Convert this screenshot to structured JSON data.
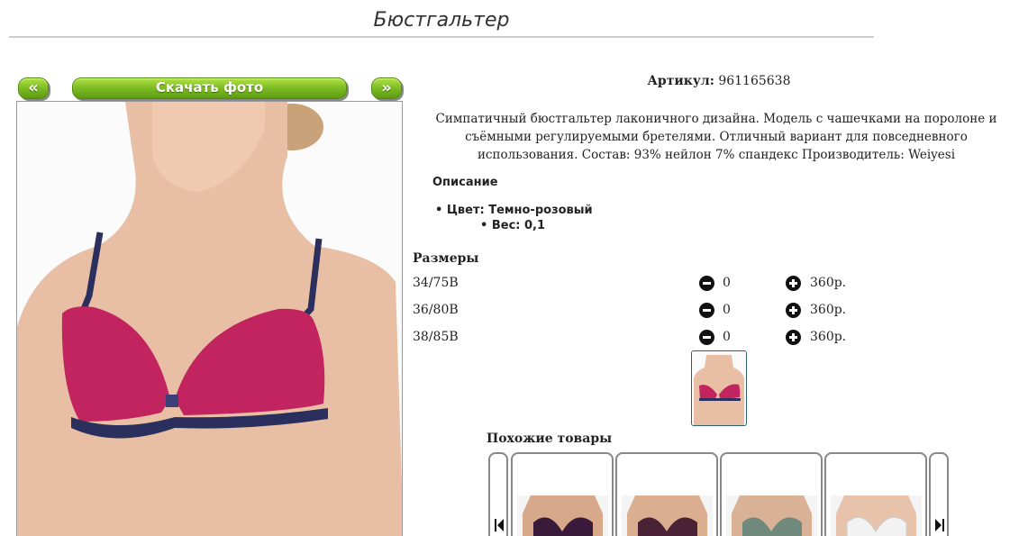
{
  "page": {
    "title": "Бюстгальтер"
  },
  "toolbar": {
    "prev_label": "«",
    "download_label": "Скачать фото",
    "next_label": "»"
  },
  "product": {
    "article_label": "Артикул:",
    "article_value": "961165638",
    "description": "Симпатичный бюстгальтер лаконичного дизайна. Модель с чашечками на поролоне и съёмными регулируемыми бретелями. Отличный вариант для повседневного использования. Состав: 93% нейлон 7% спандекс Производитель: Weiyesi",
    "description_heading": "Описание",
    "attributes": [
      {
        "text": "Цвет: Темно-розовый"
      },
      {
        "text": "Вес: 0,1"
      }
    ],
    "main_photo_colors": {
      "skin": "#e8bfa4",
      "cup": "#c2245f",
      "trim": "#2a2f5e"
    }
  },
  "sizes": {
    "heading": "Размеры",
    "rows": [
      {
        "size": "34/75B",
        "qty": "0",
        "price": "360р."
      },
      {
        "size": "36/80B",
        "qty": "0",
        "price": "360р."
      },
      {
        "size": "38/85B",
        "qty": "0",
        "price": "360р."
      }
    ]
  },
  "similar": {
    "heading": "Похожие товары",
    "items": [
      {
        "color": "#3a1a3a"
      },
      {
        "color": "#4a2236"
      },
      {
        "color": "#6f8a7c"
      },
      {
        "color": "#f2f2f2"
      }
    ]
  },
  "icons": {
    "minus": "minus-circle-icon",
    "plus": "plus-circle-icon",
    "prev": "skip-previous-icon",
    "next": "skip-next-icon"
  }
}
